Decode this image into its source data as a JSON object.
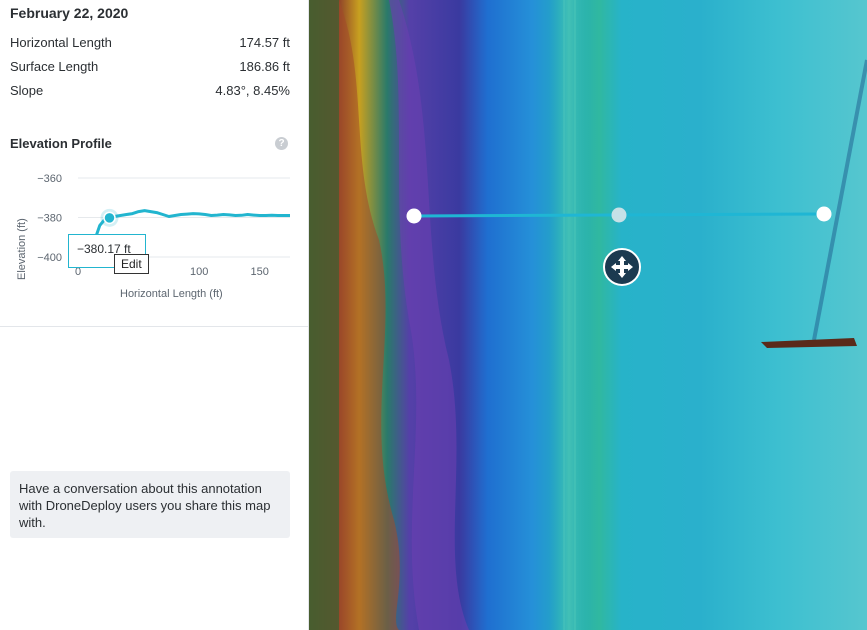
{
  "sidebar": {
    "date": "February 22, 2020",
    "metrics": [
      {
        "label": "Horizontal Length",
        "value": "174.57 ft"
      },
      {
        "label": "Surface Length",
        "value": "186.86 ft"
      },
      {
        "label": "Slope",
        "value": "4.83°, 8.45%"
      }
    ],
    "elevation_profile_title": "Elevation Profile",
    "help_icon": "?",
    "tooltip_value": "−380.17 ft",
    "edit_label": "Edit",
    "conversation_text": "Have a conversation about this annotation with DroneDeploy users you share this map with.",
    "collapse_icon": "chevron-left-icon"
  },
  "chart_data": {
    "type": "line",
    "xlabel": "Horizontal Length (ft)",
    "ylabel": "Elevation (ft)",
    "xlim": [
      0,
      175
    ],
    "ylim": [
      -400,
      -360
    ],
    "x_ticks": [
      "0",
      "100",
      "150"
    ],
    "y_ticks": [
      "−360",
      "−380",
      "−400"
    ],
    "grid": true,
    "series": [
      {
        "x": [
          10,
          14,
          18,
          22,
          26,
          30,
          35,
          40,
          45,
          50,
          55,
          60,
          65,
          70,
          75,
          80,
          85,
          90,
          95,
          100,
          105,
          110,
          115,
          120,
          125,
          130,
          135,
          140,
          145,
          150,
          155,
          160,
          165,
          170,
          175
        ],
        "y": [
          -400,
          -391,
          -384,
          -381,
          -380.17,
          -379.5,
          -379,
          -378.5,
          -378,
          -377,
          -376.5,
          -377,
          -377.5,
          -378.5,
          -379.5,
          -379,
          -378.5,
          -378.3,
          -378,
          -378.2,
          -378.5,
          -379,
          -378.8,
          -378.5,
          -378.7,
          -379,
          -378.9,
          -378.5,
          -378.8,
          -379,
          -379,
          -378.9,
          -379,
          -379,
          -379
        ]
      }
    ],
    "highlight": {
      "x": 26,
      "y": -380.17
    },
    "color": "#22b5cf"
  },
  "map": {
    "move_handle_icon": "move-icon",
    "colors": {
      "deep": "#2a2c8e",
      "mid": "#1f6fd0",
      "cyan": "#27b3c9",
      "light": "#56c6cf",
      "line": "#1fb6d4"
    }
  }
}
